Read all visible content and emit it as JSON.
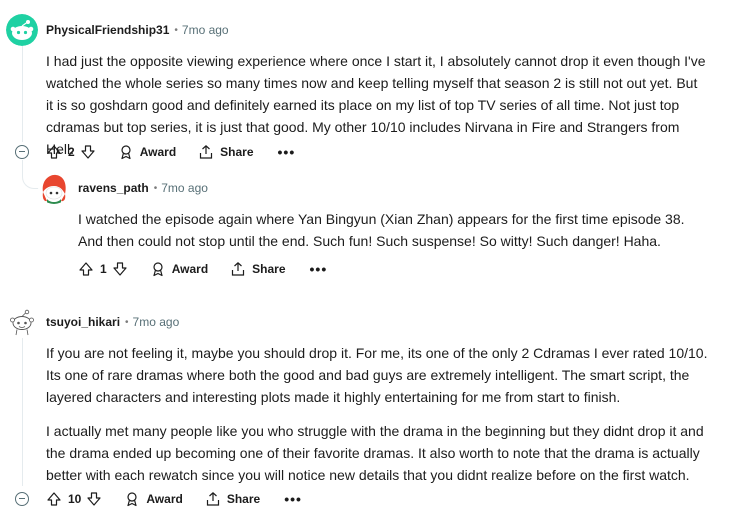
{
  "comments": [
    {
      "username": "PhysicalFriendship31",
      "time": "7mo ago",
      "avatar_color": "#1fd1a3",
      "paragraphs": [
        "I had just the opposite viewing experience where once I start it, I absolutely cannot drop it even though I've watched the whole series so many times now and keep telling myself that season 2 is still not out yet. But it is so goshdarn good and definitely earned its place on my list of top TV series of all time. Not just top cdramas but top series, it is just that good. My other 10/10 includes Nirvana in Fire and Strangers from Hell."
      ],
      "votes": "2"
    },
    {
      "username": "ravens_path",
      "time": "7mo ago",
      "avatar_color": "#e8462f",
      "paragraphs": [
        "I watched the episode again where Yan Bingyun (Xian Zhan) appears for the first time episode 38. And then could not stop until the end. Such fun! Such suspense! So witty! Such danger! Haha."
      ],
      "votes": "1"
    },
    {
      "username": "tsuyoi_hikari",
      "time": "7mo ago",
      "avatar_color": "#ffffff",
      "paragraphs": [
        "If you are not feeling it, maybe you should drop it. For me, its one of the only 2 Cdramas I ever rated 10/10. Its one of rare dramas where both the good and bad guys are extremely intelligent. The smart script, the layered characters and interesting plots made it highly entertaining for me from start to finish.",
        "I actually met many people like you who struggle with the drama in the beginning but they didnt drop it and the drama ended up becoming one of their favorite dramas. It also worth to note that the drama is actually better with each rewatch since you will notice new details that you didnt realize before on the first watch."
      ],
      "votes": "10"
    }
  ],
  "actions": {
    "award_label": "Award",
    "share_label": "Share",
    "more_label": "•••"
  },
  "separator": "•"
}
